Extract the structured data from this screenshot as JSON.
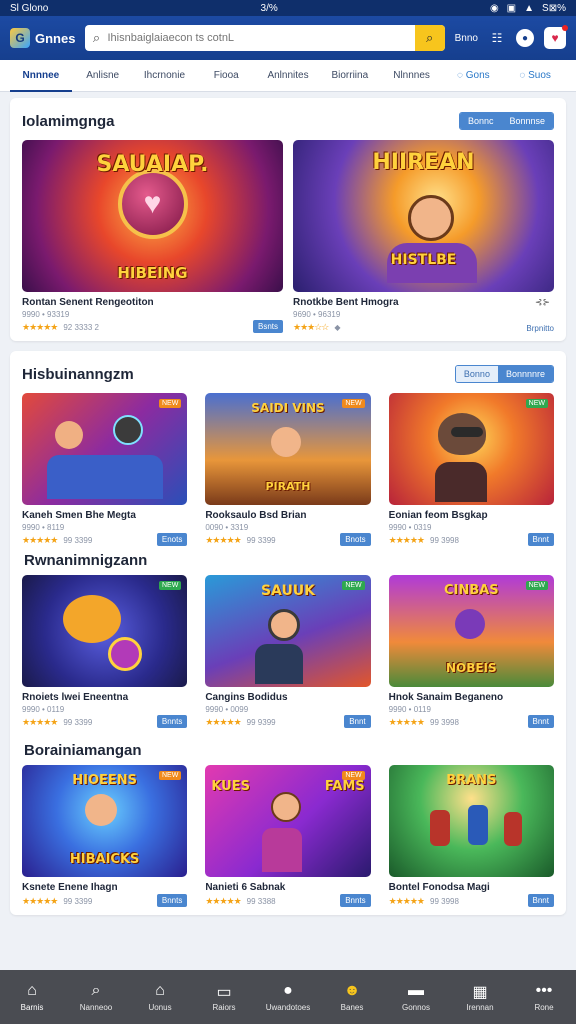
{
  "status": {
    "carrier": "Sl Glono",
    "center": "3/%",
    "battery": "S⊠%"
  },
  "header": {
    "app_name": "Gnnes",
    "search_placeholder": "Ihisnbaiglaiaecon ts cotnL",
    "link": "Bnno"
  },
  "tabs": [
    {
      "label": "Nnnnee"
    },
    {
      "label": "Anlisne"
    },
    {
      "label": "Ihcrnonie"
    },
    {
      "label": "Fiooa"
    },
    {
      "label": "Anlnnites"
    },
    {
      "label": "Biorriina"
    },
    {
      "label": "Nlnnnes"
    },
    {
      "label": "Gons"
    },
    {
      "label": "Suos"
    }
  ],
  "section1": {
    "title": "Iolamimgnga",
    "toggle": [
      "Bonnc",
      "Bonnnse"
    ],
    "games": [
      {
        "art_title": "HIBEING",
        "name": "Rontan Senent Rengeotiton",
        "sub": "9990 • 93319",
        "stars": "★★★★★",
        "count": "92 3333 2",
        "button": "Bsnts"
      },
      {
        "art_title": "HISTLBE",
        "name": "Rnotkbe Bent Hmogra",
        "sub": "9690 • 96319",
        "stars": "★★★☆☆",
        "count": "◆",
        "button": "Brpnitto",
        "share": "⊰⊱"
      }
    ]
  },
  "section2": {
    "title": "Hisbuinanngzm",
    "toggle": [
      "Bonno",
      "Bonnnnre"
    ],
    "games": [
      {
        "art_title": "",
        "name": "Kaneh Smen Bhe Megta",
        "sub": "9990 • 8119",
        "stars": "★★★★★",
        "count": "99 3399",
        "button": "Enots"
      },
      {
        "art_title": "PIRATH",
        "name": "Rooksaulo Bsd Brian",
        "sub": "0090 • 3319",
        "stars": "★★★★★",
        "count": "99 3399",
        "button": "Bnots"
      },
      {
        "art_title": "",
        "name": "Eonian feom Bsgkap",
        "sub": "9990 • 0319",
        "stars": "★★★★★",
        "count": "99 3998",
        "button": "Bnnt"
      }
    ]
  },
  "section3": {
    "title": "Rwnanimnigzann",
    "games": [
      {
        "art_title": "",
        "name": "Rnoiets lwei Eneentna",
        "sub": "9990 • 0119",
        "stars": "★★★★★",
        "count": "99 3399",
        "button": "Bnnts"
      },
      {
        "art_title": "",
        "name": "Cangins Bodidus",
        "sub": "9990 • 0099",
        "stars": "★★★★★",
        "count": "99 9399",
        "button": "Bnnt"
      },
      {
        "art_title": "NOBEIS",
        "name": "Hnok Sanaim Beganeno",
        "sub": "9990 • 0119",
        "stars": "★★★★★",
        "count": "99 3998",
        "button": "Bnnt"
      }
    ]
  },
  "section4": {
    "title": "Borainiamangan",
    "games": [
      {
        "art_title": "HIBAICKS",
        "name": "Ksnete Enene Ihagn",
        "sub": "9990 • 3119",
        "stars": "★★★★★",
        "count": "99 3399",
        "button": "Bnnts"
      },
      {
        "art_title": "",
        "name": "Nanieti 6 Sabnak",
        "sub": "9990 • 0119",
        "stars": "★★★★★",
        "count": "99 3388",
        "button": "Bnnts"
      },
      {
        "art_title": "",
        "name": "Bontel Fonodsa Magi",
        "sub": "9990 • 0119",
        "stars": "★★★★★",
        "count": "99 3998",
        "button": "Bnnt"
      }
    ]
  },
  "bottom_nav": [
    {
      "label": "Barnis",
      "icon": "home-icon"
    },
    {
      "label": "Nanneoo",
      "icon": "search-icon"
    },
    {
      "label": "Uonus",
      "icon": "store-icon"
    },
    {
      "label": "Raiors",
      "icon": "library-icon"
    },
    {
      "label": "Uwandotoes",
      "icon": "drop-icon"
    },
    {
      "label": "Banes",
      "icon": "face-icon"
    },
    {
      "label": "Gonnos",
      "icon": "gamepad-icon"
    },
    {
      "label": "Irennan",
      "icon": "grid-icon"
    },
    {
      "label": "Rone",
      "icon": "more-icon"
    }
  ],
  "colors": {
    "header": "#163f8e",
    "accent": "#4a86cf",
    "star": "#f4a316",
    "nav": "#4a4c52"
  }
}
